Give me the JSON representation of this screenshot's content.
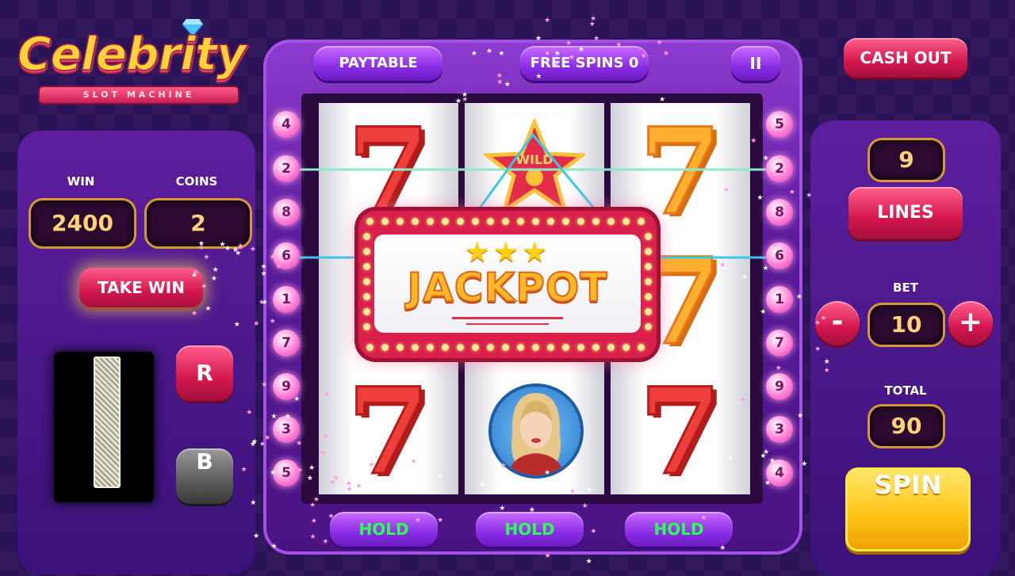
{
  "logo": {
    "title": "Celebrity",
    "subtitle": "SLOT MACHINE"
  },
  "top_bar": {
    "paytable": "PAYTABLE",
    "free_spins": "FREE SPINS 0",
    "pause": "II",
    "cash_out": "CASH OUT"
  },
  "left": {
    "win_label": "WIN",
    "win_value": "2400",
    "coins_label": "COINS",
    "coins_value": "2",
    "take_win": "TAKE WIN",
    "r_button": "R",
    "b_button": "B"
  },
  "right": {
    "lines_value": "9",
    "lines_label": "LINES",
    "bet_label": "BET",
    "bet_value": "10",
    "minus": "-",
    "plus": "+",
    "total_label": "TOTAL",
    "total_value": "90",
    "spin": "SPIN"
  },
  "reels": {
    "wild_label": "WILD",
    "symbols": [
      [
        "7",
        "7",
        "7"
      ],
      [
        "7",
        "WILD",
        "celebrity"
      ],
      [
        "7",
        "7",
        "7"
      ]
    ]
  },
  "jackpot": {
    "text": "JACKPOT",
    "stars": "★★★"
  },
  "left_bulbs": [
    "4",
    "2",
    "8",
    "6",
    "1",
    "7",
    "9",
    "3",
    "5"
  ],
  "right_bulbs": [
    "5",
    "2",
    "8",
    "6",
    "1",
    "7",
    "9",
    "3",
    "4"
  ],
  "hold": [
    "HOLD",
    "HOLD",
    "HOLD"
  ],
  "colors": {
    "accent_gold": "#ffd23a",
    "button_red": "#d3174d",
    "button_purple": "#8a2ee6",
    "hold_green": "#2cff53",
    "spin_yellow": "#ffcf1a"
  }
}
